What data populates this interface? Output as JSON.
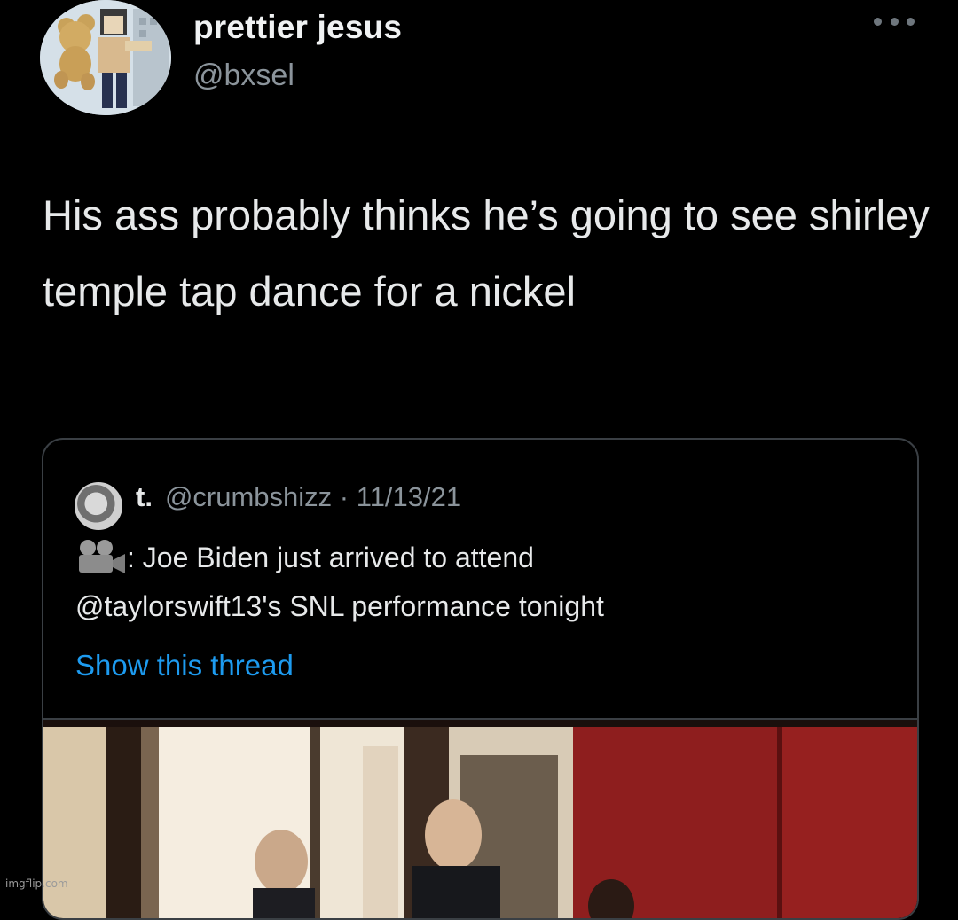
{
  "author": {
    "display_name": "prettier jesus",
    "handle": "@bxsel"
  },
  "tweet": {
    "text": "His ass probably thinks he’s going to see shirley temple tap dance for a nickel"
  },
  "quoted_tweet": {
    "name": "t.",
    "handle": "@crumbshizz",
    "separator": "·",
    "date": "11/13/21",
    "line1": ": Joe Biden just arrived to attend",
    "line2": "@taylorswift13's SNL performance tonight",
    "thread_link": "Show this thread",
    "media_icon": "closed-captions-icon"
  },
  "watermark": "imgflip.com",
  "colors": {
    "background": "#000000",
    "text": "#e7e9ea",
    "muted": "#8b949b",
    "link": "#1d9bf0",
    "border": "#3a3f44"
  }
}
